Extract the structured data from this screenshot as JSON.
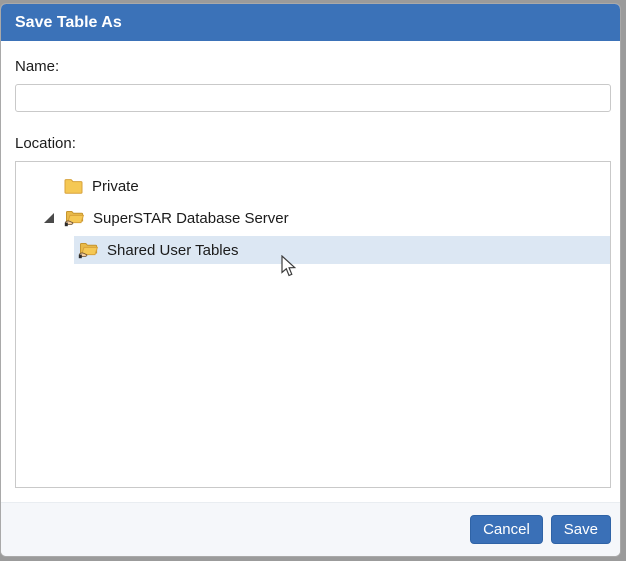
{
  "dialog": {
    "title": "Save Table As",
    "name_label": "Name:",
    "name_value": "",
    "location_label": "Location:",
    "tree": {
      "items": [
        {
          "label": "Private",
          "level": 1,
          "icon": "folder-icon",
          "expanded": false,
          "selected": false
        },
        {
          "label": "SuperSTAR Database Server",
          "level": 1,
          "icon": "shared-folder-icon",
          "expanded": true,
          "selected": false
        },
        {
          "label": "Shared User Tables",
          "level": 2,
          "icon": "shared-folder-icon",
          "expanded": false,
          "selected": true
        }
      ]
    },
    "buttons": {
      "cancel": "Cancel",
      "save": "Save"
    },
    "colors": {
      "titlebar_blue": "#3b72b8",
      "button_blue": "#3a70b7",
      "selection_highlight": "#dce7f3",
      "footer_background": "#f5f7fa",
      "folder_yellow": "#f5c854"
    }
  }
}
